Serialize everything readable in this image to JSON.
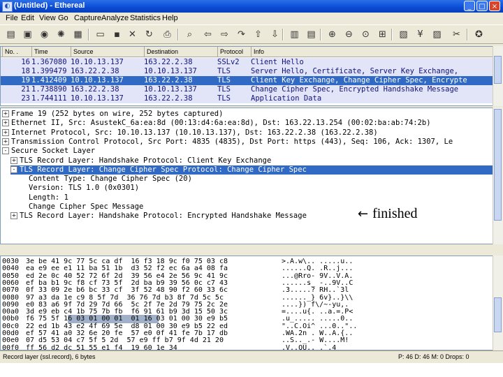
{
  "window": {
    "title": "(Untitled) - Ethereal",
    "app_icon": "ethereal-icon",
    "minimize": "_",
    "maximize": "□",
    "close": "×"
  },
  "menu": [
    "File",
    "Edit",
    "View",
    "Go",
    "Capture",
    "Analyze",
    "Statistics",
    "Help"
  ],
  "toolbar": [
    {
      "name": "interface-list-icon",
      "glyph": "▤"
    },
    {
      "name": "capture-options-icon",
      "glyph": "▣"
    },
    {
      "name": "start-capture-icon",
      "glyph": "◉"
    },
    {
      "name": "restart-capture-icon",
      "glyph": "✺"
    },
    {
      "name": "stop-capture-icon",
      "glyph": "▦"
    },
    {
      "name": "open-icon",
      "glyph": "▭"
    },
    {
      "name": "save-icon",
      "glyph": "▪"
    },
    {
      "name": "close-file-icon",
      "glyph": "✕"
    },
    {
      "name": "reload-icon",
      "glyph": "↻"
    },
    {
      "name": "print-icon",
      "glyph": "⎙"
    },
    {
      "name": "find-icon",
      "glyph": "⌕"
    },
    {
      "name": "back-icon",
      "glyph": "⇦"
    },
    {
      "name": "forward-icon",
      "glyph": "⇨"
    },
    {
      "name": "go-to-packet-icon",
      "glyph": "↷"
    },
    {
      "name": "first-packet-icon",
      "glyph": "⇧"
    },
    {
      "name": "last-packet-icon",
      "glyph": "⇩"
    },
    {
      "name": "colorize-icon",
      "glyph": "▥"
    },
    {
      "name": "auto-scroll-icon",
      "glyph": "▤"
    },
    {
      "name": "zoom-in-icon",
      "glyph": "⊕"
    },
    {
      "name": "zoom-out-icon",
      "glyph": "⊖"
    },
    {
      "name": "zoom-normal-icon",
      "glyph": "⊙"
    },
    {
      "name": "resize-columns-icon",
      "glyph": "⊞"
    },
    {
      "name": "capture-filter-icon",
      "glyph": "▧"
    },
    {
      "name": "display-filter-icon",
      "glyph": "¥"
    },
    {
      "name": "coloring-rules-icon",
      "glyph": "▨"
    },
    {
      "name": "preferences-icon",
      "glyph": "✂"
    },
    {
      "name": "help-icon",
      "glyph": "✪"
    }
  ],
  "packet_list": {
    "columns": [
      "No. .",
      "Time",
      "Source",
      "Destination",
      "Protocol",
      "Info"
    ],
    "rows": [
      {
        "no": "16",
        "time": "1.367080",
        "source": "10.10.13.137",
        "destination": "163.22.2.38",
        "protocol": "SSLv2",
        "info": "Client Hello"
      },
      {
        "no": "18",
        "time": "1.399479",
        "source": "163.22.2.38",
        "destination": "10.10.13.137",
        "protocol": "TLS",
        "info": "Server Hello, Certificate, Server Key Exchange,"
      },
      {
        "no": "19",
        "time": "1.412409",
        "source": "10.10.13.137",
        "destination": "163.22.2.38",
        "protocol": "TLS",
        "info": "Client Key Exchange, Change Cipher Spec, Encrypte"
      },
      {
        "no": "21",
        "time": "1.738890",
        "source": "163.22.2.38",
        "destination": "10.10.13.137",
        "protocol": "TLS",
        "info": "Change Cipher Spec, Encrypted Handshake Message"
      },
      {
        "no": "23",
        "time": "1.744111",
        "source": "10.10.13.137",
        "destination": "163.22.2.38",
        "protocol": "TLS",
        "info": "Application Data"
      }
    ],
    "selected_index": 2
  },
  "packet_details": [
    {
      "indent": 0,
      "expander": "+",
      "text": "Frame 19 (252 bytes on wire, 252 bytes captured)"
    },
    {
      "indent": 0,
      "expander": "+",
      "text": "Ethernet II, Src: AsustekC_6a:ea:8d (00:13:d4:6a:ea:8d), Dst: 163.22.13.254 (00:02:ba:ab:74:2b)"
    },
    {
      "indent": 0,
      "expander": "+",
      "text": "Internet Protocol, Src: 10.10.13.137 (10.10.13.137), Dst: 163.22.2.38 (163.22.2.38)"
    },
    {
      "indent": 0,
      "expander": "+",
      "text": "Transmission Control Protocol, Src Port: 4835 (4835), Dst Port: https (443), Seq: 106, Ack: 1307, Le"
    },
    {
      "indent": 0,
      "expander": "-",
      "text": "Secure Socket Layer"
    },
    {
      "indent": 1,
      "expander": "+",
      "text": "TLS Record Layer: Handshake Protocol: Client Key Exchange"
    },
    {
      "indent": 1,
      "expander": "-",
      "text": "TLS Record Layer: Change Cipher Spec Protocol: Change Cipher Spec"
    },
    {
      "indent": 2,
      "expander": "",
      "text": "Content Type: Change Cipher Spec (20)"
    },
    {
      "indent": 2,
      "expander": "",
      "text": "Version: TLS 1.0 (0x0301)"
    },
    {
      "indent": 2,
      "expander": "",
      "text": "Length: 1"
    },
    {
      "indent": 2,
      "expander": "",
      "text": "Change Cipher Spec Message"
    },
    {
      "indent": 1,
      "expander": "+",
      "text": "TLS Record Layer: Handshake Protocol: Encrypted Handshake Message"
    }
  ],
  "details_selected_index": 6,
  "hex_dump": [
    {
      "offset": "0030",
      "hex": "3e be 41 9c 77 5c ca df  16 f3 18 9c f0 75 03 c8",
      "ascii": ">.A.w\\.. .....u.."
    },
    {
      "offset": "0040",
      "hex": "ea e9 ee e1 11 ba 51 1b  d3 52 f2 ec 6a a4 08 fa",
      "ascii": "......Q. .R..j..."
    },
    {
      "offset": "0050",
      "hex": "ed 2e 0c 40 52 72 6f 2d  39 56 e4 2e 56 9c 41 9c",
      "ascii": "...@Rro- 9V..V.A."
    },
    {
      "offset": "0060",
      "hex": "ef ba b1 9c f8 cf 73 5f  2d ba b9 39 56 0c c7 43",
      "ascii": "......s_ -..9V..C"
    },
    {
      "offset": "0070",
      "hex": "0f 33 09 2e b6 bc 33 cf  3f 52 48 90 f2 60 33 6c",
      "ascii": ".3.....? RH..`3l"
    },
    {
      "offset": "0080",
      "hex": "97 a3 da 1e c9 8 5f 7d  36 76 7d b3 8f 7d 5c 5c",
      "ascii": "......_} 6v}..}\\\\"
    },
    {
      "offset": "0090",
      "hex": "e0 83 a6 9f 7d 29 7d 66  5c 2f 7e 2d 79 75 2c 2e",
      "ascii": "....}) f\\/~-yu,."
    },
    {
      "offset": "00a0",
      "hex": "3d e9 eb c4 1b 75 7b fb  f6 91 61 b9 3d 15 50 3c",
      "ascii": "=....u{. ..a.=.P<"
    },
    {
      "offset": "00b0",
      "hex": "f6 75 5f 16 03 01 00 01  01 16 03 01 00 30 e9 b5",
      "ascii": ".u_..... .....0.."
    },
    {
      "offset": "00c0",
      "hex": "22 ed 1b 43 e2 4f 69 5e  d8 01 00 30 e9 b5 22 ed",
      "ascii": "\"..C.Oi^ ...0..\".."
    },
    {
      "offset": "00d0",
      "hex": "ef 57 41 a0 32 6e 20 fe  57 e0 0f 41 fe 7b 17 db",
      "ascii": ".WA.2n . W..A.{.."
    },
    {
      "offset": "00e0",
      "hex": "07 d5 53 04 c7 5f 5 2d  57 e9 ff b7 9f 4d 21 20",
      "ascii": "..S.._.- W....M! "
    },
    {
      "offset": "00f0",
      "hex": "ff 56 d2 dc 51 55 e1 f4  19 60 1e 34",
      "ascii": ".V..QU.. .`.4"
    }
  ],
  "status": {
    "left": "Record layer (ssl.record), 6 bytes",
    "right": "P: 46 D: 46 M: 0 Drops: 0"
  },
  "annotation": {
    "arrow": "←",
    "text": "finished"
  },
  "colors": {
    "selection": "#316ac5",
    "ssl_row": "#e2e5f7",
    "window_chrome": "#ece9d8",
    "title_blue": "#0a4bd6"
  }
}
